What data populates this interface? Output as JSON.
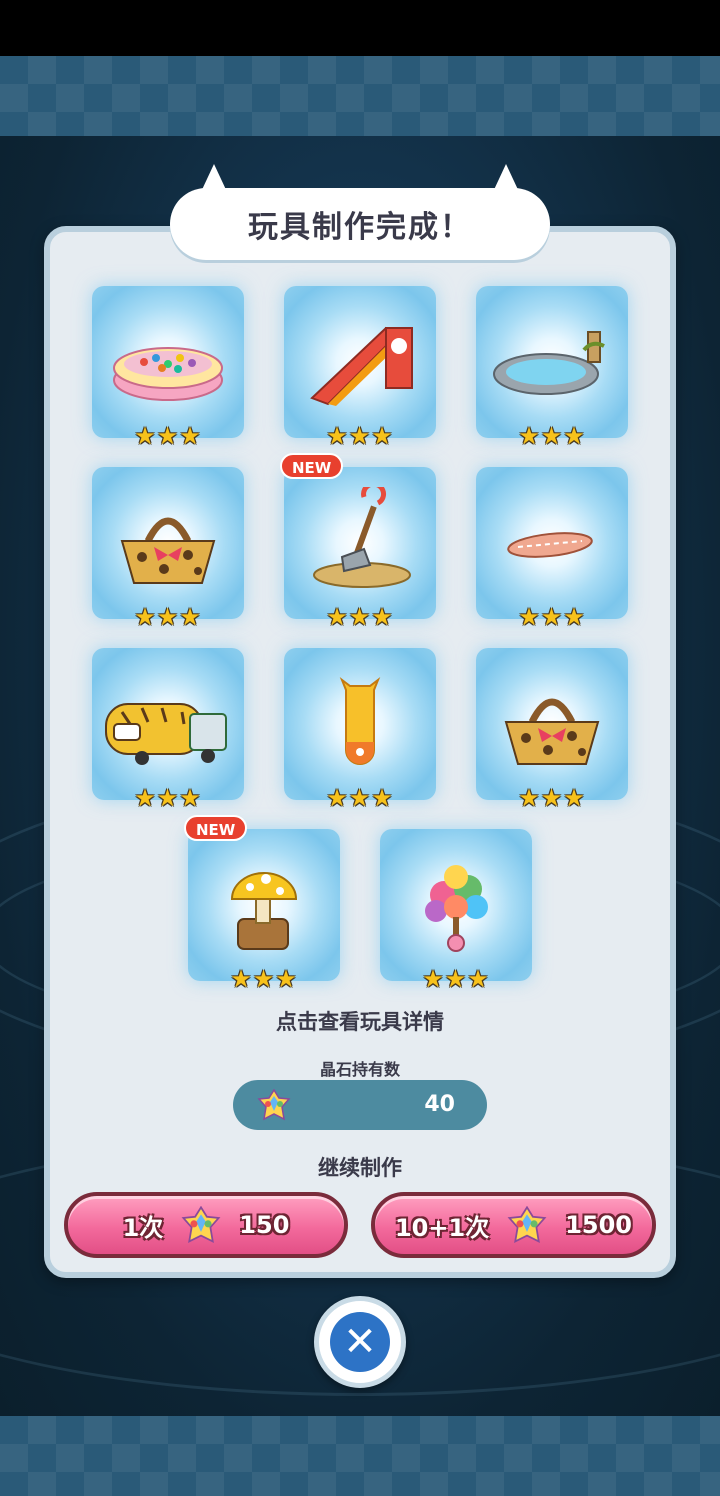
{
  "dialog": {
    "title": "玩具制作完成！",
    "hint": "点击查看玩具详情",
    "crystal_label": "晶石持有数",
    "crystal_count": "40",
    "continue_label": "继续制作"
  },
  "toys": [
    {
      "name": "ball-pool",
      "stars": "★★★",
      "new": false
    },
    {
      "name": "slide",
      "stars": "★★★",
      "new": false
    },
    {
      "name": "pond",
      "stars": "★★★",
      "new": false
    },
    {
      "name": "leopard-basket",
      "stars": "★★★",
      "new": false
    },
    {
      "name": "sandbox-shovel",
      "stars": "★★★",
      "new": true,
      "badge": "NEW"
    },
    {
      "name": "surfboard",
      "stars": "★★★",
      "new": false
    },
    {
      "name": "tiger-bus",
      "stars": "★★★",
      "new": false
    },
    {
      "name": "punching-bag",
      "stars": "★★★",
      "new": false
    },
    {
      "name": "leopard-basket-2",
      "stars": "★★★",
      "new": false
    },
    {
      "name": "mushroom-stump",
      "stars": "★★★",
      "new": true,
      "badge": "NEW"
    },
    {
      "name": "candy-tree",
      "stars": "★★★",
      "new": false
    }
  ],
  "buttons": {
    "single": {
      "label": "1次",
      "cost": "150"
    },
    "multi": {
      "label": "10+1次",
      "cost": "1500"
    }
  },
  "colors": {
    "panel": "#e6ecf1",
    "button_pink": "#f36a9c",
    "close_blue": "#2d73c6",
    "star_gold": "#f7c21b"
  }
}
